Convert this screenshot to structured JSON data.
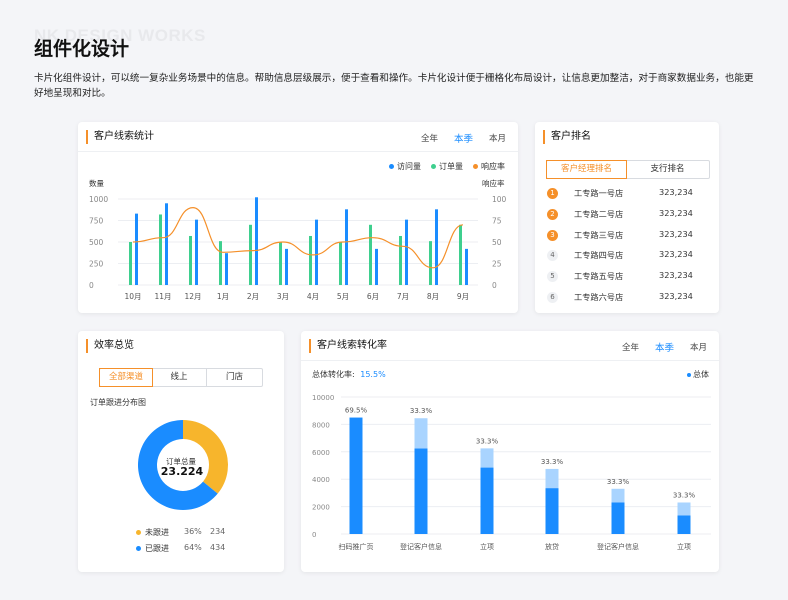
{
  "page": {
    "watermark": "NK DESIGN WORKS",
    "title": "组件化设计",
    "intro": "卡片化组件设计，可以统一复杂业务场景中的信息。帮助信息层级展示，便于查看和操作。卡片化设计便于栅格化布局设计，让信息更加整洁，对于商家数据业务，也能更好地呈现和对比。"
  },
  "colors": {
    "accent": "#f5902a",
    "blue": "#1a8cff",
    "green": "#3ecf8e",
    "lightblue": "#a9d4ff"
  },
  "leads_card": {
    "title": "客户线索统计",
    "tabs": [
      "全年",
      "本季",
      "本月"
    ],
    "active_tab": "本季",
    "legend": [
      "访问量",
      "订单量",
      "响应率"
    ],
    "left_axis_title": "数量",
    "right_axis_title": "响应率"
  },
  "rank_card": {
    "title": "客户排名",
    "segments": [
      "客户经理排名",
      "支行排名"
    ],
    "active_segment": "客户经理排名",
    "rows": [
      {
        "rank": "1",
        "name": "工专路一号店",
        "value": "323,234"
      },
      {
        "rank": "2",
        "name": "工专路二号店",
        "value": "323,234"
      },
      {
        "rank": "3",
        "name": "工专路三号店",
        "value": "323,234"
      },
      {
        "rank": "4",
        "name": "工专路四号店",
        "value": "323,234"
      },
      {
        "rank": "5",
        "name": "工专路五号店",
        "value": "323,234"
      },
      {
        "rank": "6",
        "name": "工专路六号店",
        "value": "323,234"
      }
    ]
  },
  "efficiency_card": {
    "title": "效率总览",
    "segments": [
      "全部渠道",
      "线上",
      "门店"
    ],
    "active_segment": "全部渠道",
    "subtitle": "订单跟进分布图",
    "center_label": "订单总量",
    "center_value": "23.224",
    "legend": [
      {
        "name": "未跟进",
        "pct": "36%",
        "count": "234",
        "color": "#f7b52c"
      },
      {
        "name": "已跟进",
        "pct": "64%",
        "count": "434",
        "color": "#1a8cff"
      }
    ]
  },
  "conversion_card": {
    "title": "客户线索转化率",
    "tabs": [
      "全年",
      "本季",
      "本月"
    ],
    "active_tab": "本季",
    "total_label": "总体转化率:",
    "total_value": "15.5%",
    "legend": "总体"
  },
  "chart_data": [
    {
      "type": "bar",
      "title": "",
      "categories": [
        "10月",
        "11月",
        "12月",
        "1月",
        "2月",
        "3月",
        "4月",
        "5月",
        "6月",
        "7月",
        "8月",
        "9月"
      ],
      "ylabel": "数量",
      "y2label": "响应率",
      "ylim": [
        0,
        1000
      ],
      "y2lim": [
        0,
        100
      ],
      "yticks": [
        0,
        250,
        500,
        750,
        1000
      ],
      "y2ticks": [
        0,
        25,
        50,
        75,
        100
      ],
      "legend_position": "top-right",
      "grid": true,
      "series": [
        {
          "name": "访问量",
          "color": "#1a8cff",
          "values": [
            830,
            950,
            760,
            370,
            1020,
            420,
            760,
            880,
            420,
            760,
            880,
            420
          ]
        },
        {
          "name": "订单量",
          "color": "#3ecf8e",
          "values": [
            500,
            820,
            570,
            510,
            700,
            500,
            570,
            500,
            700,
            570,
            510,
            700
          ]
        },
        {
          "name": "响应率",
          "color": "#f5902a",
          "type": "line",
          "values": [
            50,
            55,
            90,
            38,
            40,
            50,
            35,
            50,
            55,
            45,
            20,
            70
          ]
        }
      ]
    },
    {
      "type": "bar",
      "title": "",
      "subtype": "stacked",
      "categories": [
        "扫码推广页",
        "登记客户信息",
        "立项",
        "放贷",
        "登记客户信息",
        "立项"
      ],
      "ylim": [
        0,
        10000
      ],
      "yticks": [
        0,
        2000,
        4000,
        6000,
        8000,
        10000
      ],
      "grid": true,
      "legend_position": "top-right",
      "series": [
        {
          "name": "总体",
          "color": "#1a8cff",
          "values": [
            8500,
            6250,
            4850,
            3350,
            2300,
            1350
          ]
        },
        {
          "color": "#a9d4ff",
          "values": [
            0,
            2200,
            1400,
            1400,
            1000,
            950
          ]
        }
      ],
      "labels": [
        "69.5%",
        "33.3%",
        "33.3%",
        "33.3%",
        "33.3%",
        "33.3%"
      ]
    },
    {
      "type": "pie",
      "title": "",
      "subtype": "donut",
      "labels": [
        "未跟进",
        "已跟进"
      ],
      "values": [
        36,
        64
      ],
      "colors": [
        "#f7b52c",
        "#1a8cff"
      ]
    }
  ]
}
